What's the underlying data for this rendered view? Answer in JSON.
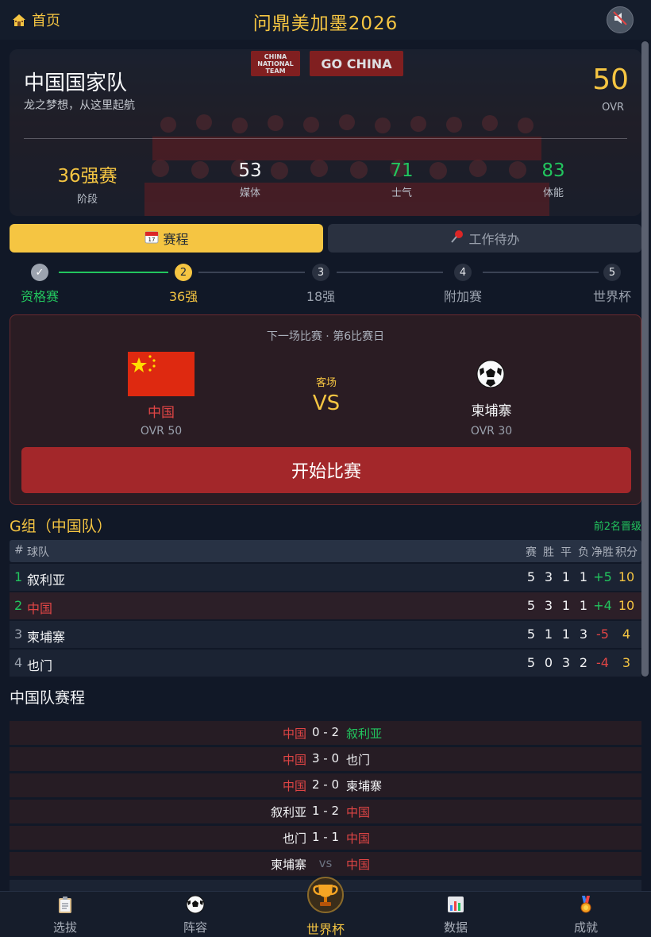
{
  "header": {
    "home_label": "首页",
    "title": "问鼎美加墨2026"
  },
  "team": {
    "name": "中国国家队",
    "slogan": "龙之梦想，从这里起航",
    "ovr": "50",
    "ovr_label": "OVR",
    "banner_left": "CHINA NATIONAL TEAM",
    "banner_right": "GO CHINA",
    "stats": [
      {
        "value": "36强赛",
        "label": "阶段"
      },
      {
        "value": "53",
        "label": "媒体"
      },
      {
        "value": "71",
        "label": "士气"
      },
      {
        "value": "83",
        "label": "体能"
      }
    ]
  },
  "tabs": {
    "schedule": "赛程",
    "todo": "工作待办"
  },
  "stepper": [
    {
      "num": "✓",
      "label": "资格赛",
      "state": "done"
    },
    {
      "num": "2",
      "label": "36强",
      "state": "current"
    },
    {
      "num": "3",
      "label": "18强",
      "state": "todo"
    },
    {
      "num": "4",
      "label": "附加赛",
      "state": "todo"
    },
    {
      "num": "5",
      "label": "世界杯",
      "state": "todo"
    }
  ],
  "next_match": {
    "header": "下一场比赛 · 第6比赛日",
    "home": {
      "name": "中国",
      "ovr": "OVR 50"
    },
    "venue": "客场",
    "vs": "VS",
    "away": {
      "name": "柬埔寨",
      "ovr": "OVR 30"
    },
    "start_label": "开始比赛"
  },
  "group": {
    "title": "G组（中国队）",
    "note": "前2名晋级",
    "headers": {
      "rank": "#",
      "team": "球队",
      "played": "赛",
      "win": "胜",
      "draw": "平",
      "loss": "负",
      "gd": "净胜",
      "pts": "积分"
    },
    "rows": [
      {
        "rank": "1",
        "team": "叙利亚",
        "played": "5",
        "win": "3",
        "draw": "1",
        "loss": "1",
        "gd": "+5",
        "pts": "10"
      },
      {
        "rank": "2",
        "team": "中国",
        "played": "5",
        "win": "3",
        "draw": "1",
        "loss": "1",
        "gd": "+4",
        "pts": "10"
      },
      {
        "rank": "3",
        "team": "柬埔寨",
        "played": "5",
        "win": "1",
        "draw": "1",
        "loss": "3",
        "gd": "-5",
        "pts": "4"
      },
      {
        "rank": "4",
        "team": "也门",
        "played": "5",
        "win": "0",
        "draw": "3",
        "loss": "2",
        "gd": "-4",
        "pts": "3"
      }
    ]
  },
  "fixtures": {
    "title": "中国队赛程",
    "items": [
      {
        "home": "中国",
        "score": "0 - 2",
        "away": "叙利亚"
      },
      {
        "home": "中国",
        "score": "3 - 0",
        "away": "也门"
      },
      {
        "home": "中国",
        "score": "2 - 0",
        "away": "柬埔寨"
      },
      {
        "home": "叙利亚",
        "score": "1 - 2",
        "away": "中国"
      },
      {
        "home": "也门",
        "score": "1 - 1",
        "away": "中国"
      },
      {
        "home": "柬埔寨",
        "score": "vs",
        "away": "中国"
      }
    ]
  },
  "nav": [
    {
      "label": "选拔",
      "icon": "clipboard-icon"
    },
    {
      "label": "阵容",
      "icon": "football-icon"
    },
    {
      "label": "世界杯",
      "icon": "trophy-icon"
    },
    {
      "label": "数据",
      "icon": "chart-icon"
    },
    {
      "label": "成就",
      "icon": "medal-icon"
    }
  ],
  "colors": {
    "accent": "#f5c542",
    "red": "#e04545",
    "green": "#22c55e",
    "bg": "#111827"
  }
}
